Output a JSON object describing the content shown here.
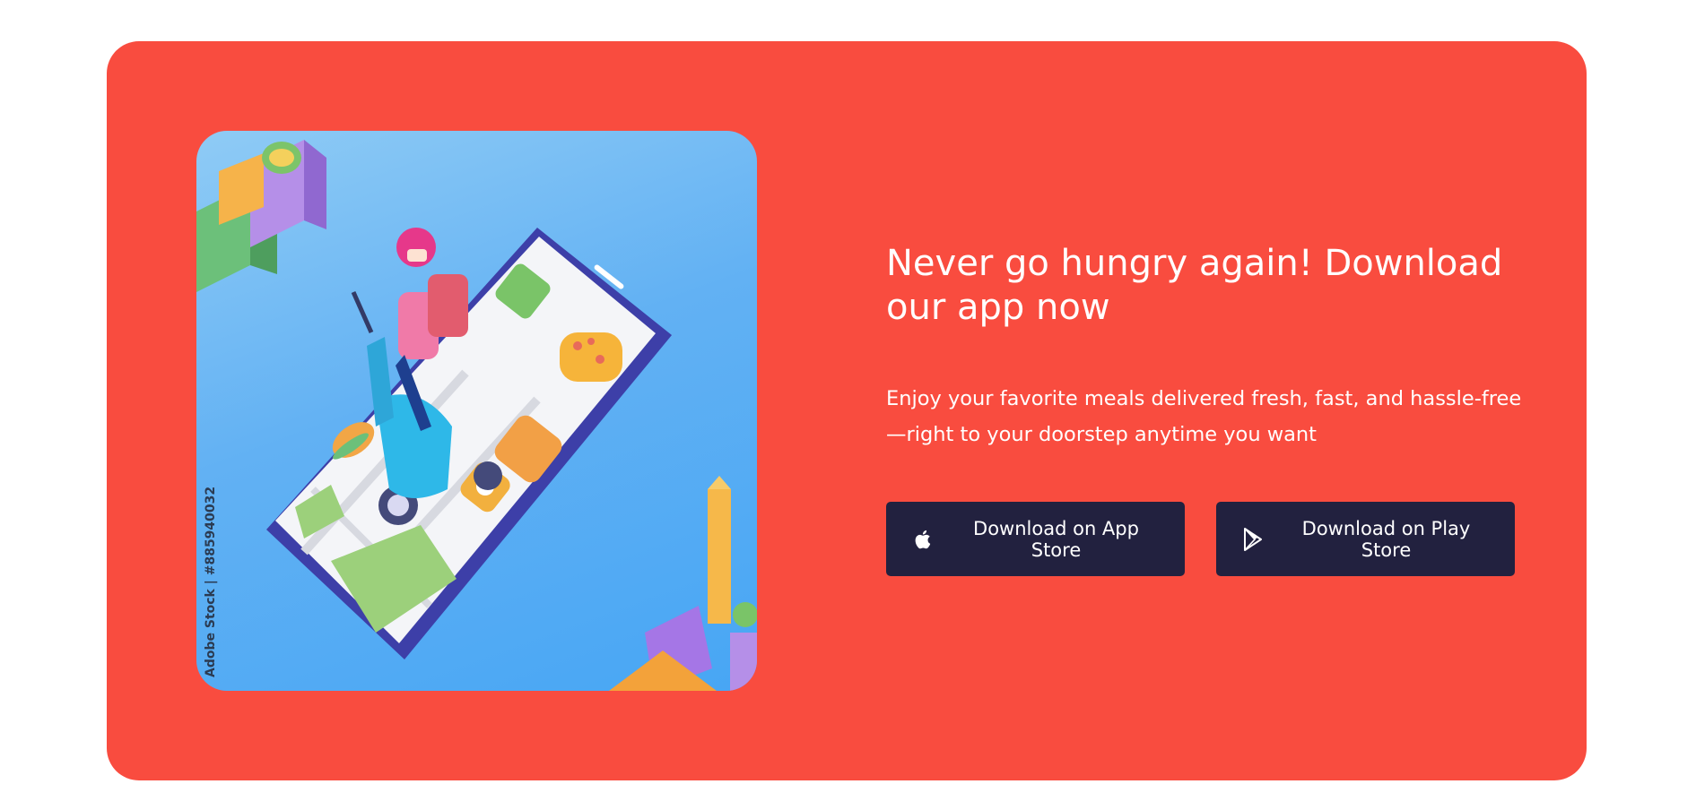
{
  "banner": {
    "background_color": "#f94c3f",
    "headline": "Never go hungry again! Download our app now",
    "subtext": "Enjoy your favorite meals delivered fresh, fast, and hassle-free —right to your doorstep anytime you want",
    "illustration": {
      "description_icon": "delivery-scooter-phone-illustration",
      "watermark_text": "Adobe Stock | #885940032"
    }
  },
  "buttons": {
    "app_store": {
      "label": "Download on App Store",
      "icon": "apple-icon"
    },
    "play_store": {
      "label": "Download on Play Store",
      "icon": "play-store-icon"
    },
    "background_color": "#22213f"
  }
}
